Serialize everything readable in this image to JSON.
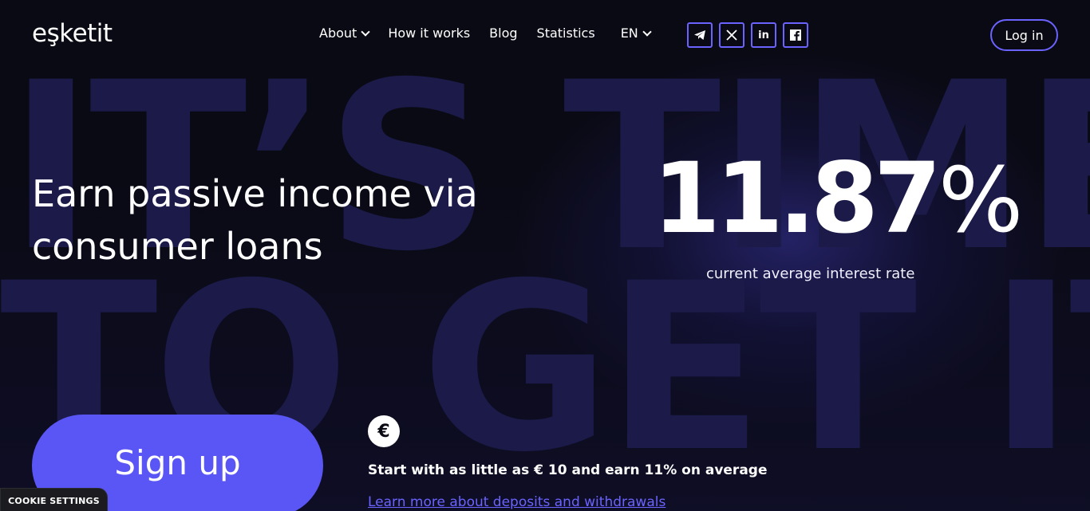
{
  "brand": {
    "logo_text": "eşketit"
  },
  "background": {
    "line1": "IT’S TIME",
    "line2": "TO GET IT"
  },
  "nav": {
    "items": [
      {
        "label": "About",
        "has_dropdown": true
      },
      {
        "label": "How it works",
        "has_dropdown": false
      },
      {
        "label": "Blog",
        "has_dropdown": false
      },
      {
        "label": "Statistics",
        "has_dropdown": false
      }
    ],
    "language": "EN"
  },
  "socials": [
    {
      "name": "telegram-icon",
      "glyph": "➤"
    },
    {
      "name": "x-icon",
      "glyph": "𝕏"
    },
    {
      "name": "linkedin-icon",
      "glyph": "in"
    },
    {
      "name": "facebook-icon",
      "glyph": "f"
    }
  ],
  "login_label": "Log in",
  "hero": {
    "headline": "Earn passive income via consumer loans",
    "rate_value": "11.87",
    "rate_symbol": "%",
    "rate_label": "current average interest rate"
  },
  "signup_label": "Sign up",
  "deposit": {
    "icon": "euro-icon",
    "glyph": "€",
    "text": "Start with as little as € 10 and earn 11% on average",
    "link": "Learn more about deposits and withdrawals"
  },
  "cookie_label": "COOKIE SETTINGS",
  "colors": {
    "accent": "#5a55f5",
    "background": "#0a0a14",
    "outline": "#6a63ff"
  }
}
